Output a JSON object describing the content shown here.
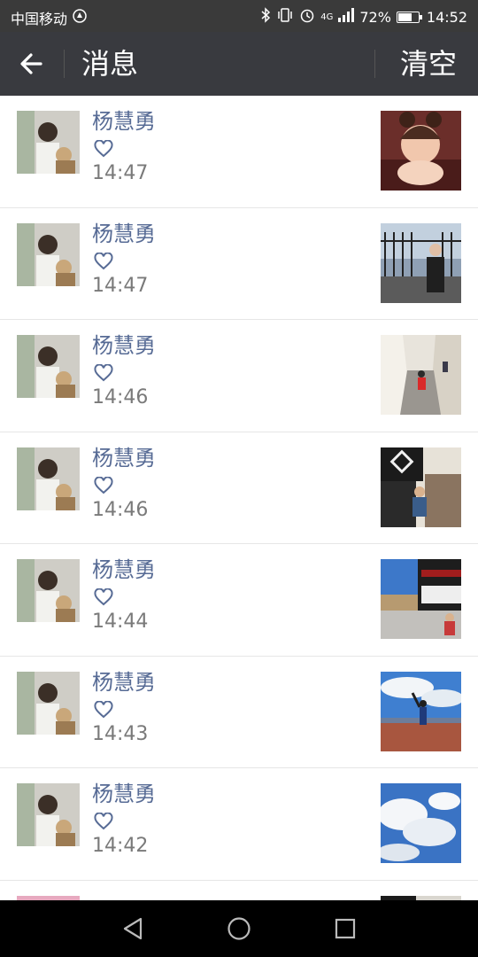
{
  "status_bar": {
    "carrier": "中国移动",
    "network": "4G",
    "battery_percent": "72%",
    "battery_level": 0.72,
    "time": "14:52",
    "icons": [
      "notification-icon",
      "bluetooth-icon",
      "vibrate-icon",
      "alarm-icon",
      "signal-icon",
      "battery-icon"
    ]
  },
  "header": {
    "back_icon": "back-arrow-icon",
    "title": "消息",
    "clear_label": "清空"
  },
  "messages": [
    {
      "sender": "杨慧勇",
      "time": "14:47",
      "type": "like",
      "thumb": "baby-in-bear-hat"
    },
    {
      "sender": "杨慧勇",
      "time": "14:47",
      "type": "like",
      "thumb": "person-by-fence"
    },
    {
      "sender": "杨慧勇",
      "time": "14:46",
      "type": "like",
      "thumb": "street-stairs"
    },
    {
      "sender": "杨慧勇",
      "time": "14:46",
      "type": "like",
      "thumb": "person-seated-doorway"
    },
    {
      "sender": "杨慧勇",
      "time": "14:44",
      "type": "like",
      "thumb": "tibetan-building"
    },
    {
      "sender": "杨慧勇",
      "time": "14:43",
      "type": "like",
      "thumb": "person-under-sky"
    },
    {
      "sender": "杨慧勇",
      "time": "14:42",
      "type": "like",
      "thumb": "clouds-sky"
    },
    {
      "sender": "",
      "time": "",
      "type": "partial",
      "thumb": "partial"
    }
  ],
  "colors": {
    "title_bar": "#393a3f",
    "status_bar": "#3a3a3a",
    "sender_name": "#576b95",
    "timestamp": "#7a7a7a",
    "divider": "#e6e6e6",
    "nav_bar": "#000000"
  },
  "nav": {
    "back": "nav-back-icon",
    "home": "nav-home-icon",
    "recents": "nav-recents-icon"
  }
}
